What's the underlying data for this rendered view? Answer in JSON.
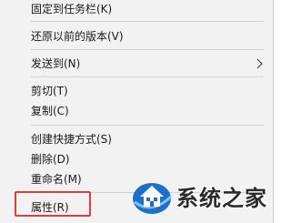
{
  "context_menu": {
    "items": [
      {
        "label": "固定到任务栏(K)"
      },
      {
        "label": "还原以前的版本(V)"
      },
      {
        "label": "发送到(N)"
      },
      {
        "label": "剪切(T)"
      },
      {
        "label": "复制(C)"
      },
      {
        "label": "创建快捷方式(S)"
      },
      {
        "label": "删除(D)"
      },
      {
        "label": "重命名(M)"
      },
      {
        "label": "属性(R)"
      }
    ]
  },
  "highlight": {
    "target": "属性(R)",
    "color": "#e03c3c"
  },
  "watermark": {
    "text": "系统之家",
    "icon": "house-logo-icon",
    "color": "#1e6fc8"
  }
}
